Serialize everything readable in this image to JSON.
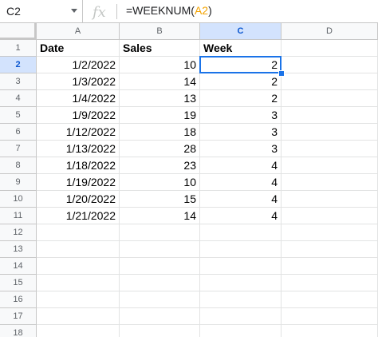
{
  "formula_bar": {
    "name_box": "C2",
    "formula_prefix": "=WEEKNUM(",
    "formula_ref": "A2",
    "formula_suffix": ")"
  },
  "columns": [
    "A",
    "B",
    "C",
    "D"
  ],
  "active_cell": {
    "column": "C",
    "row": 2
  },
  "row_numbers": [
    "1",
    "2",
    "3",
    "4",
    "5",
    "6",
    "7",
    "8",
    "9",
    "10",
    "11",
    "12",
    "13",
    "14",
    "15",
    "16",
    "17",
    "18"
  ],
  "headers": [
    "Date",
    "Sales",
    "Week"
  ],
  "rows": [
    {
      "date": "1/2/2022",
      "sales": "10",
      "week": "2"
    },
    {
      "date": "1/3/2022",
      "sales": "14",
      "week": "2"
    },
    {
      "date": "1/4/2022",
      "sales": "13",
      "week": "2"
    },
    {
      "date": "1/9/2022",
      "sales": "19",
      "week": "3"
    },
    {
      "date": "1/12/2022",
      "sales": "18",
      "week": "3"
    },
    {
      "date": "1/13/2022",
      "sales": "28",
      "week": "3"
    },
    {
      "date": "1/18/2022",
      "sales": "23",
      "week": "4"
    },
    {
      "date": "1/19/2022",
      "sales": "10",
      "week": "4"
    },
    {
      "date": "1/20/2022",
      "sales": "15",
      "week": "4"
    },
    {
      "date": "1/21/2022",
      "sales": "14",
      "week": "4"
    }
  ],
  "colors": {
    "selection": "#1a73e8",
    "formula_reference": "#f4a300",
    "header_bg": "#f8f9fa",
    "active_header_bg": "#d3e3fd"
  }
}
